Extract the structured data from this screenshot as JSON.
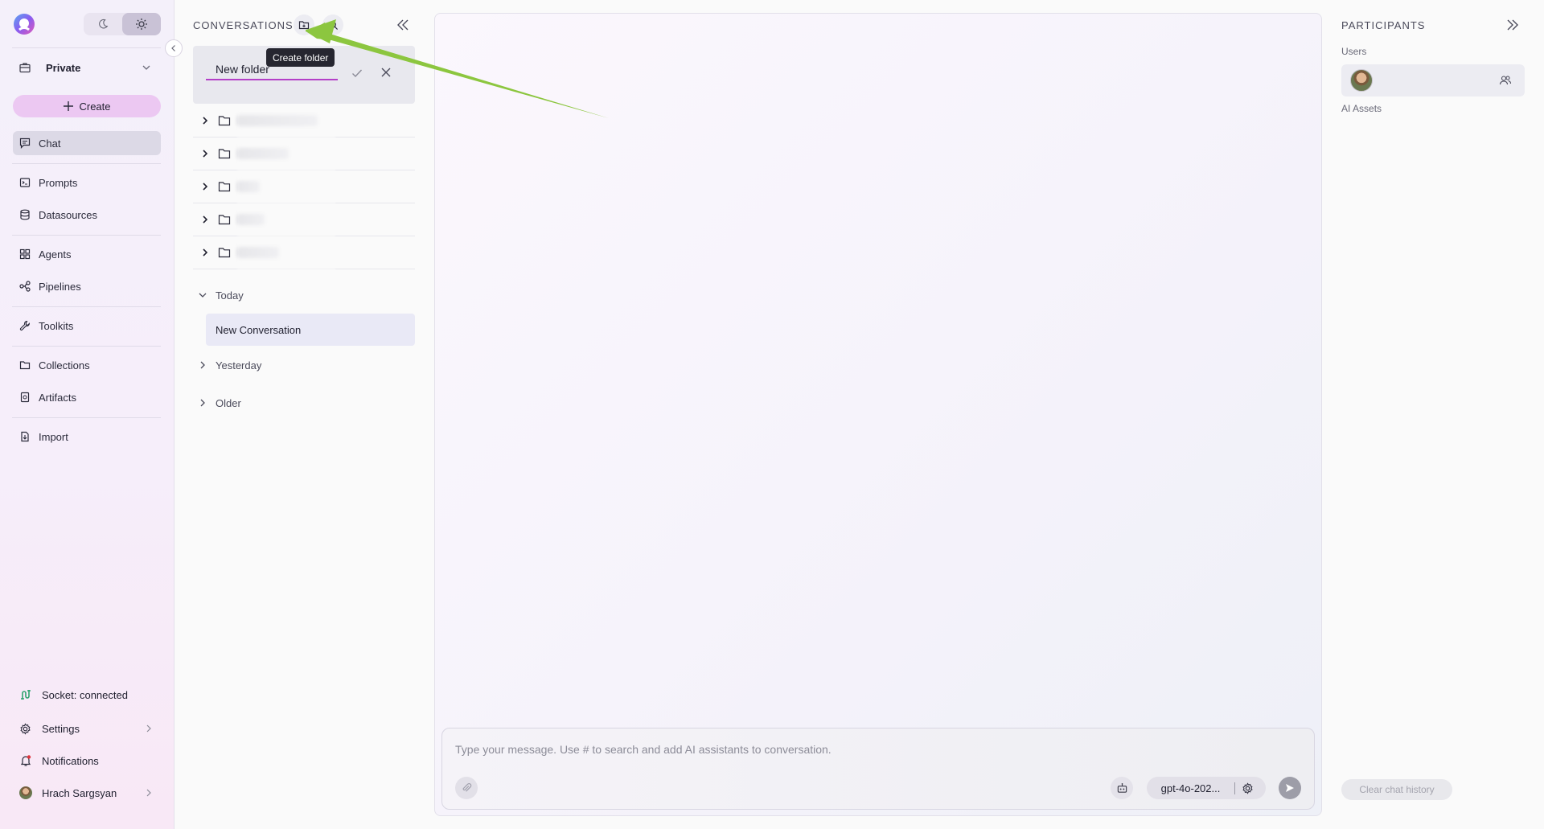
{
  "sidebar": {
    "workspace": "Private",
    "create_label": "Create",
    "nav": [
      {
        "label": "Chat",
        "icon": "chat-icon"
      },
      {
        "label": "Prompts",
        "icon": "prompt-icon"
      },
      {
        "label": "Datasources",
        "icon": "database-icon"
      },
      {
        "label": "Agents",
        "icon": "grid-icon"
      },
      {
        "label": "Pipelines",
        "icon": "pipeline-icon"
      },
      {
        "label": "Toolkits",
        "icon": "wrench-icon"
      },
      {
        "label": "Collections",
        "icon": "folder-icon"
      },
      {
        "label": "Artifacts",
        "icon": "artifact-icon"
      },
      {
        "label": "Import",
        "icon": "import-icon"
      }
    ],
    "bottom": {
      "socket": "Socket: connected",
      "settings": "Settings",
      "notifications": "Notifications",
      "user": "Hrach Sargsyan"
    }
  },
  "conversations": {
    "title": "CONVERSATIONS",
    "tooltip": "Create folder",
    "new_folder_value": "New folder",
    "groups": {
      "today": "Today",
      "yesterday": "Yesterday",
      "older": "Older"
    },
    "today_items": [
      "New Conversation"
    ]
  },
  "chat": {
    "placeholder": "Type your message. Use # to search and add AI assistants to conversation.",
    "model": "gpt-4o-202..."
  },
  "participants": {
    "title": "PARTICIPANTS",
    "users_label": "Users",
    "ai_assets_label": "AI Assets",
    "clear_label": "Clear chat history"
  },
  "colors": {
    "accent": "#b43fc8",
    "create_bg": "#ecc8f2",
    "annotation_arrow": "#8cc63f"
  }
}
